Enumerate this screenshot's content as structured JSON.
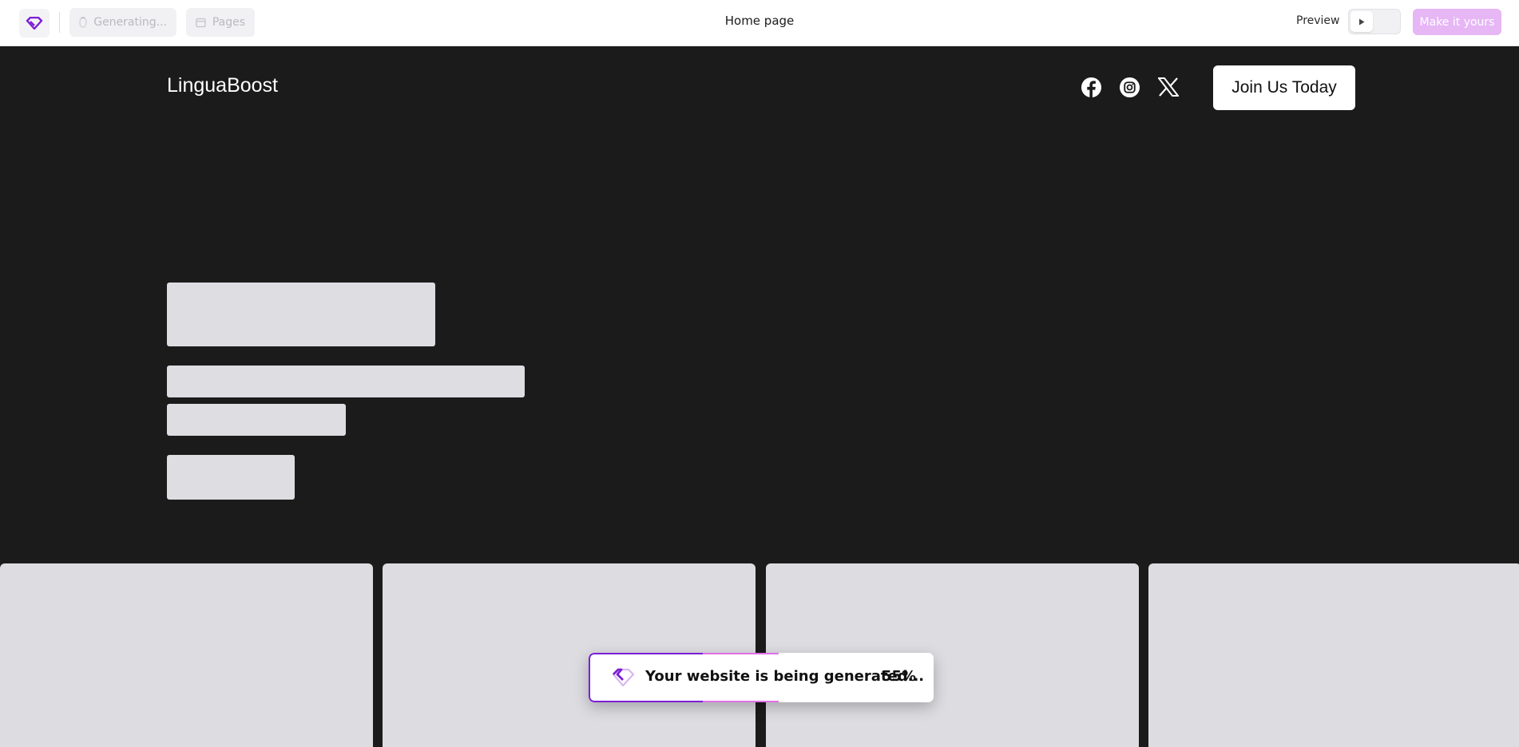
{
  "toolbar": {
    "generating_label": "Generating...",
    "pages_label": "Pages",
    "page_title": "Home page",
    "preview_label": "Preview",
    "make_it_yours_label": "Make it yours",
    "accent_color": "#7c1fd6",
    "make_btn_color": "#e6b6f5"
  },
  "site": {
    "brand": "LinguaBoost",
    "social_icons": [
      "facebook-icon",
      "instagram-icon",
      "x-twitter-icon"
    ],
    "cta_label": "Join Us Today",
    "background_color": "#1b1b1b",
    "skeleton_color": "#dddde2"
  },
  "toast": {
    "message": "Your website is being generated...",
    "progress_text": "55%",
    "progress_fraction": 0.55
  }
}
